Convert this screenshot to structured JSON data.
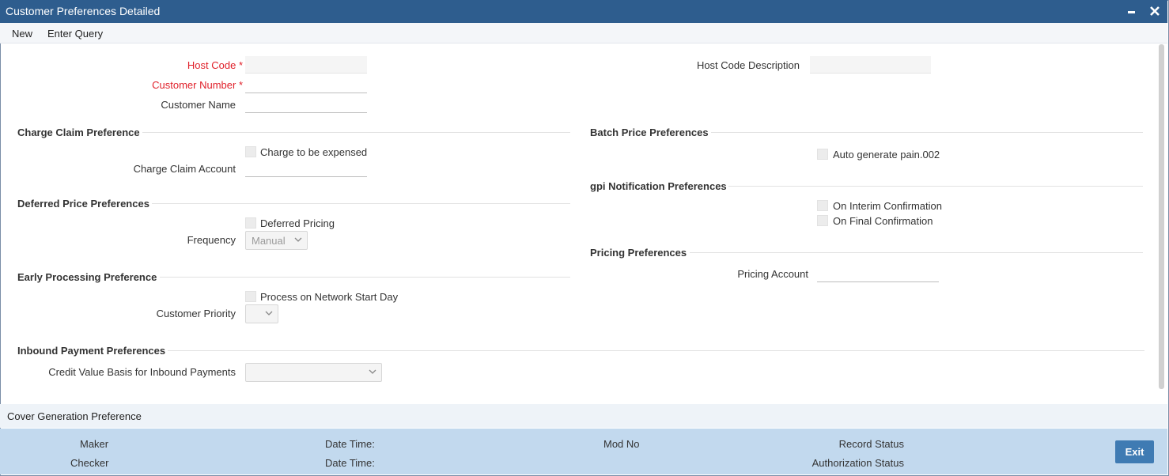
{
  "window": {
    "title": "Customer Preferences Detailed",
    "minimize_icon": "minimize-icon",
    "close_icon": "close-icon"
  },
  "menu": {
    "new": "New",
    "enter_query": "Enter Query"
  },
  "header": {
    "host_code_label": "Host Code",
    "customer_number_label": "Customer Number",
    "customer_name_label": "Customer Name",
    "host_code_description_label": "Host Code Description",
    "required_marker": "*",
    "host_code_value": "",
    "customer_number_value": "",
    "customer_name_value": "",
    "host_code_description_value": ""
  },
  "charge_claim": {
    "title": "Charge Claim Preference",
    "charge_to_be_expensed": "Charge to be expensed",
    "charge_claim_account": "Charge Claim Account"
  },
  "deferred": {
    "title": "Deferred Price Preferences",
    "deferred_pricing": "Deferred Pricing",
    "frequency_label": "Frequency",
    "frequency_value": "Manual"
  },
  "early": {
    "title": "Early Processing Preference",
    "process_on_network_start_day": "Process on Network Start Day",
    "customer_priority_label": "Customer Priority",
    "customer_priority_value": ""
  },
  "inbound": {
    "title": "Inbound Payment Preferences",
    "credit_value_basis_label": "Credit Value Basis for Inbound Payments",
    "credit_value_basis_value": ""
  },
  "batch": {
    "title": "Batch Price Preferences",
    "auto_generate": "Auto generate pain.002"
  },
  "gpi": {
    "title": "gpi Notification Preferences",
    "on_interim": "On Interim Confirmation",
    "on_final": "On Final Confirmation"
  },
  "pricing": {
    "title": "Pricing Preferences",
    "pricing_account_label": "Pricing Account"
  },
  "cover": {
    "label": "Cover Generation Preference"
  },
  "footer": {
    "maker": "Maker",
    "checker": "Checker",
    "date_time_1": "Date Time:",
    "date_time_2": "Date Time:",
    "mod_no": "Mod No",
    "record_status": "Record Status",
    "authorization_status": "Authorization Status",
    "exit": "Exit"
  },
  "colors": {
    "title_bar": "#2e5d8e",
    "footer": "#c2d9ee",
    "required": "#e0202a",
    "exit_button": "#3f7bb3"
  }
}
